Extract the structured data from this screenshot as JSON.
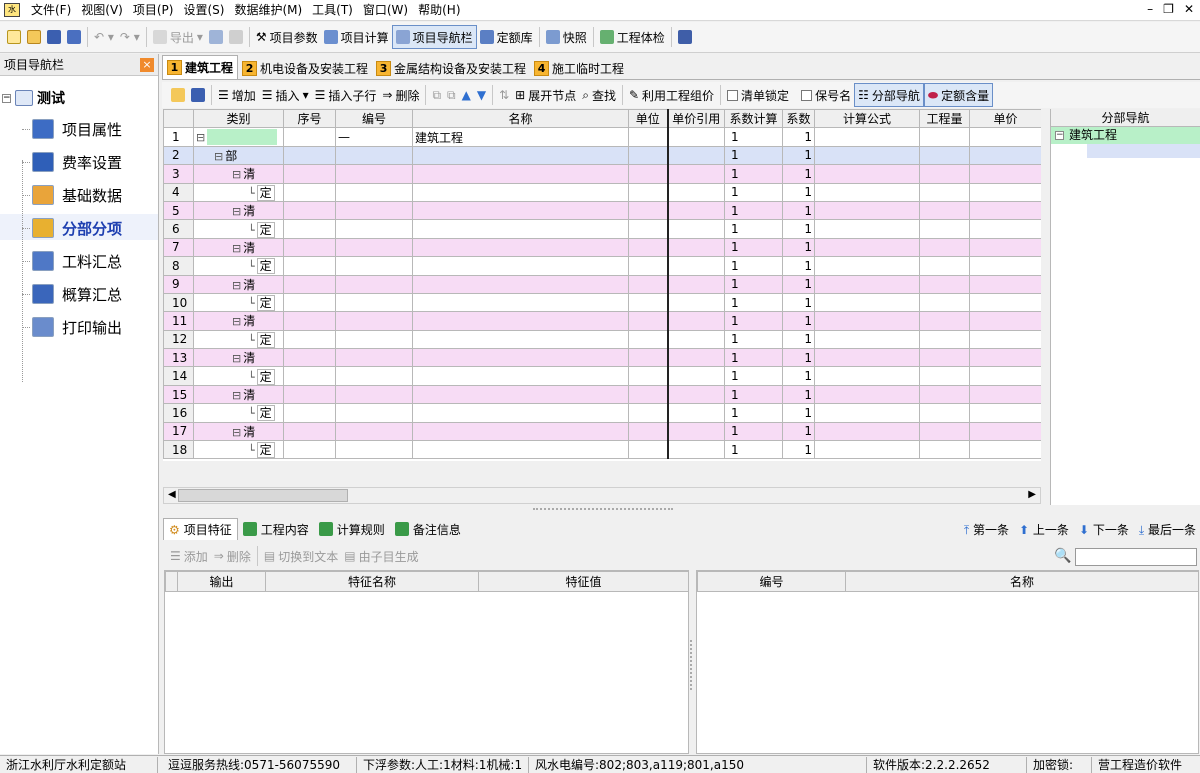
{
  "menu": [
    "文件(F)",
    "视图(V)",
    "项目(P)",
    "设置(S)",
    "数据维护(M)",
    "工具(T)",
    "窗口(W)",
    "帮助(H)"
  ],
  "toolbar": {
    "export": "导出",
    "project_params": "项目参数",
    "project_calc": "项目计算",
    "project_nav": "项目导航栏",
    "quota_lib": "定额库",
    "snapshot": "快照",
    "project_check": "工程体检"
  },
  "leftnav": {
    "title": "项目导航栏",
    "close_label": "×",
    "root": "测试",
    "items": [
      "项目属性",
      "费率设置",
      "基础数据",
      "分部分项",
      "工料汇总",
      "概算汇总",
      "打印输出"
    ]
  },
  "doc_tabs": [
    {
      "num": "1",
      "label": "建筑工程"
    },
    {
      "num": "2",
      "label": "机电设备及安装工程"
    },
    {
      "num": "3",
      "label": "金属结构设备及安装工程"
    },
    {
      "num": "4",
      "label": "施工临时工程"
    }
  ],
  "grid_toolbar": {
    "add": "增加",
    "insert": "插入",
    "insert_child": "插入子行",
    "delete": "删除",
    "expand": "展开节点",
    "find": "查找",
    "use_group": "利用工程组价",
    "lock_list": "清单锁定",
    "keep_name": "保号名",
    "section_nav": "分部导航",
    "quota_content": "定额含量"
  },
  "grid": {
    "columns": [
      "类别",
      "序号",
      "编号",
      "名称",
      "单位",
      "单价引用",
      "系数计算",
      "系数",
      "计算公式",
      "工程量",
      "单价"
    ],
    "rows": [
      {
        "n": "1",
        "cat": "",
        "code": "—",
        "name": "建筑工程",
        "c1": "1",
        "c2": "1",
        "type": "root"
      },
      {
        "n": "2",
        "cat": "部",
        "code": "",
        "name": "",
        "c1": "1",
        "c2": "1",
        "type": "bu"
      },
      {
        "n": "3",
        "cat": "清",
        "code": "",
        "name": "",
        "c1": "1",
        "c2": "1",
        "type": "qing"
      },
      {
        "n": "4",
        "cat": "定",
        "code": "",
        "name": "",
        "c1": "1",
        "c2": "1",
        "type": "ding"
      },
      {
        "n": "5",
        "cat": "清",
        "code": "",
        "name": "",
        "c1": "1",
        "c2": "1",
        "type": "qing"
      },
      {
        "n": "6",
        "cat": "定",
        "code": "",
        "name": "",
        "c1": "1",
        "c2": "1",
        "type": "ding"
      },
      {
        "n": "7",
        "cat": "清",
        "code": "",
        "name": "",
        "c1": "1",
        "c2": "1",
        "type": "qing"
      },
      {
        "n": "8",
        "cat": "定",
        "code": "",
        "name": "",
        "c1": "1",
        "c2": "1",
        "type": "ding"
      },
      {
        "n": "9",
        "cat": "清",
        "code": "",
        "name": "",
        "c1": "1",
        "c2": "1",
        "type": "qing"
      },
      {
        "n": "10",
        "cat": "定",
        "code": "",
        "name": "",
        "c1": "1",
        "c2": "1",
        "type": "ding"
      },
      {
        "n": "11",
        "cat": "清",
        "code": "",
        "name": "",
        "c1": "1",
        "c2": "1",
        "type": "qing"
      },
      {
        "n": "12",
        "cat": "定",
        "code": "",
        "name": "",
        "c1": "1",
        "c2": "1",
        "type": "ding"
      },
      {
        "n": "13",
        "cat": "清",
        "code": "",
        "name": "",
        "c1": "1",
        "c2": "1",
        "type": "qing"
      },
      {
        "n": "14",
        "cat": "定",
        "code": "",
        "name": "",
        "c1": "1",
        "c2": "1",
        "type": "ding"
      },
      {
        "n": "15",
        "cat": "清",
        "code": "",
        "name": "",
        "c1": "1",
        "c2": "1",
        "type": "qing"
      },
      {
        "n": "16",
        "cat": "定",
        "code": "",
        "name": "",
        "c1": "1",
        "c2": "1",
        "type": "ding"
      },
      {
        "n": "17",
        "cat": "清",
        "code": "",
        "name": "",
        "c1": "1",
        "c2": "1",
        "type": "qing"
      },
      {
        "n": "18",
        "cat": "定",
        "code": "",
        "name": "",
        "c1": "1",
        "c2": "1",
        "type": "ding"
      }
    ]
  },
  "right_panel": {
    "title": "分部导航",
    "root": "建筑工程"
  },
  "bottom_tabs": [
    "项目特征",
    "工程内容",
    "计算规则",
    "备注信息"
  ],
  "record_nav": {
    "first": "第一条",
    "prev": "上一条",
    "next": "下一条",
    "last": "最后一条"
  },
  "bottom_toolbar": {
    "add": "添加",
    "delete": "删除",
    "to_text": "切换到文本",
    "from_child": "由子目生成"
  },
  "feature_grid": {
    "columns": [
      "输出",
      "特征名称",
      "特征值"
    ]
  },
  "content_grid": {
    "columns": [
      "编号",
      "名称"
    ]
  },
  "status": {
    "org": "浙江水利厅水利定额站",
    "hotline": "逗逗服务热线:0571-56075590",
    "float_params": "下浮参数:人工:1材料:1机械:1",
    "codes": "风水电编号:802;803,a119;801,a150",
    "version": "软件版本:2.2.2.2652",
    "lock": "加密锁:",
    "product": "营工程造价软件"
  }
}
